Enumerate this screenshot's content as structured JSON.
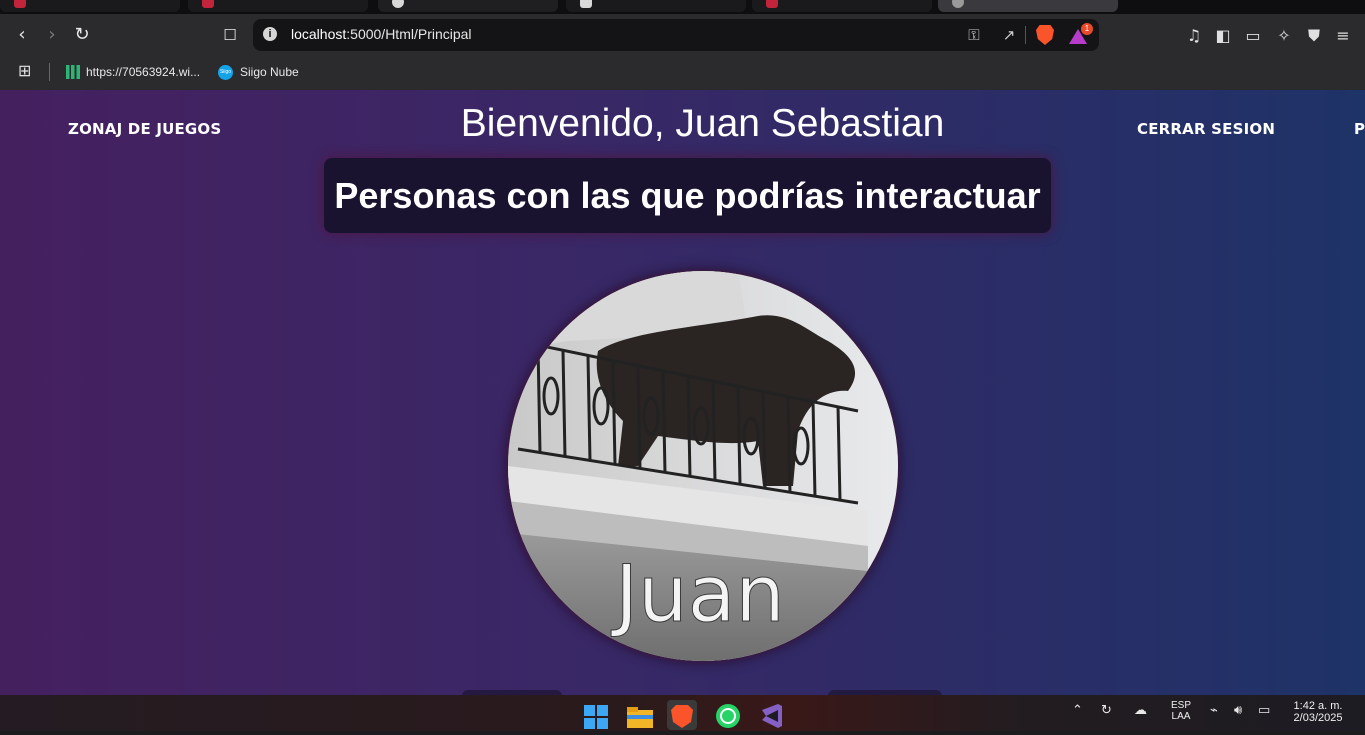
{
  "browser": {
    "tabs": [
      {
        "state": "inactive"
      },
      {
        "state": "inactive"
      },
      {
        "state": "active"
      },
      {
        "state": "inactive"
      },
      {
        "state": "inactive"
      },
      {
        "state": "inactive"
      }
    ],
    "toolbar": {
      "back_icon": "chevron-left-icon",
      "forward_icon": "chevron-right-icon",
      "reload_icon": "reload-icon",
      "bookmark_icon": "bookmark-icon",
      "url_host": "localhost",
      "url_rest": ":5000/Html/Principal",
      "rewards_badge": "1"
    },
    "bookmarks": [
      {
        "label": "https://70563924.wi...",
        "icon": "bars-icon"
      },
      {
        "label": "Siigo Nube",
        "icon": "siigo-icon",
        "icon_text": "Siigo"
      }
    ]
  },
  "page": {
    "nav_left": "ZONAJ DE JUEGOS",
    "welcome": "Bienvenido, Juan Sebastian",
    "nav_right": "CERRAR SESION",
    "nav_right_cut": "P",
    "section_title": "Personas con las que podrías interactuar",
    "profile_caption": "Juan",
    "colors": {
      "bg_left": "#45205f",
      "bg_right": "#1e3367",
      "card_bg": "#1a1330"
    }
  },
  "taskbar": {
    "tray_lang_top": "ESP",
    "tray_lang_bottom": "LAA",
    "time": "1:42 a. m.",
    "date": "2/03/2025"
  }
}
